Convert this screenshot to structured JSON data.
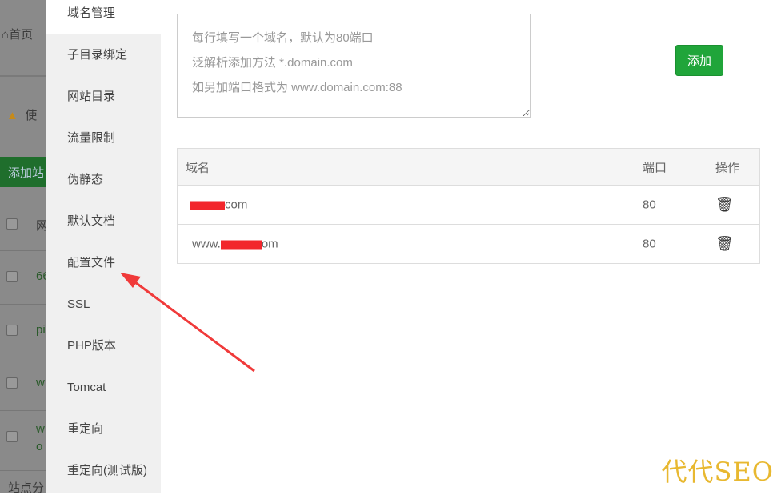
{
  "background_page": {
    "home_label": "首页",
    "warning_text": "使",
    "add_site_label": "添加站",
    "rows": [
      "网",
      "66",
      "pi",
      "w",
      "w\no"
    ],
    "footer_text": "站点分"
  },
  "sidebar": {
    "items": [
      {
        "label": "域名管理",
        "active": true
      },
      {
        "label": "子目录绑定"
      },
      {
        "label": "网站目录"
      },
      {
        "label": "流量限制"
      },
      {
        "label": "伪静态"
      },
      {
        "label": "默认文档"
      },
      {
        "label": "配置文件"
      },
      {
        "label": "SSL"
      },
      {
        "label": "PHP版本"
      },
      {
        "label": "Tomcat"
      },
      {
        "label": "重定向"
      },
      {
        "label": "重定向(测试版)"
      }
    ]
  },
  "domain_form": {
    "placeholder_lines": [
      "每行填写一个域名，默认为80端口",
      "泛解析添加方法 *.domain.com",
      "如另加端口格式为 www.domain.com:88"
    ],
    "add_button": "添加"
  },
  "table": {
    "headers": [
      "域名",
      "端口",
      "操作"
    ],
    "rows": [
      {
        "domain_prefix": "",
        "domain_suffix": "com",
        "port": "80"
      },
      {
        "domain_prefix": "www.",
        "domain_suffix": "om",
        "port": "80"
      }
    ]
  },
  "watermark": "代代SEO",
  "colors": {
    "accent": "#20a53a",
    "annotation_arrow": "#f03a3a",
    "redaction": "#f2262c"
  }
}
